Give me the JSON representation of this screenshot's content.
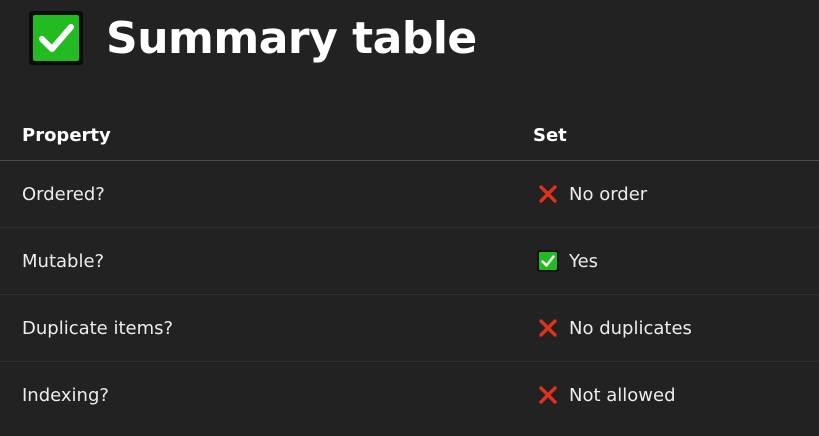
{
  "page": {
    "title": "Summary table",
    "title_icon": "check-mark-button-icon"
  },
  "table": {
    "headers": [
      "Property",
      "Set"
    ],
    "rows": [
      {
        "property": "Ordered?",
        "status_icon": "cross-mark-icon",
        "value": "No order"
      },
      {
        "property": "Mutable?",
        "status_icon": "check-mark-button-icon",
        "value": "Yes"
      },
      {
        "property": "Duplicate items?",
        "status_icon": "cross-mark-icon",
        "value": "No duplicates"
      },
      {
        "property": "Indexing?",
        "status_icon": "cross-mark-icon",
        "value": "Not allowed"
      }
    ]
  },
  "colors": {
    "background": "#222222",
    "check_green": "#22bb22",
    "cross_red": "#e0311c"
  }
}
